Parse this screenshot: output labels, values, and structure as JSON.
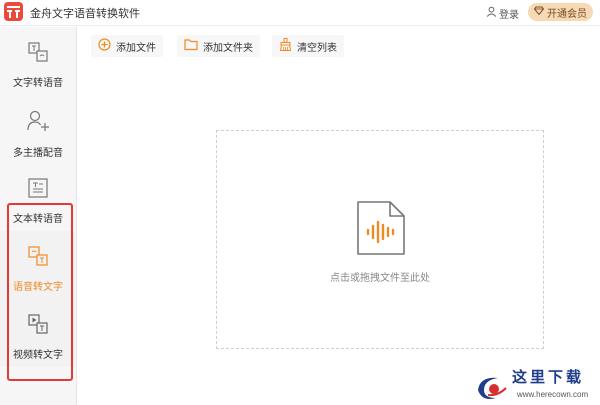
{
  "app": {
    "title": "金舟文字语音转换软件"
  },
  "header": {
    "login_label": "登录",
    "vip_label": "开通会员"
  },
  "sidebar": {
    "items": [
      {
        "label": "文字转语音",
        "active": false
      },
      {
        "label": "多主播配音",
        "active": false
      },
      {
        "label": "文本转语音",
        "active": false
      },
      {
        "label": "语音转文字",
        "active": true
      },
      {
        "label": "视频转文字",
        "active": false
      }
    ]
  },
  "toolbar": {
    "add_file": "添加文件",
    "add_folder": "添加文件夹",
    "clear_list": "清空列表"
  },
  "dropzone": {
    "hint": "点击或拖拽文件至此处"
  },
  "watermark": {
    "text": "这里下载",
    "url": "www.herecown.com"
  },
  "colors": {
    "accent": "#f08a24",
    "logo_red": "#ea4a39",
    "highlight_frame": "#e53935",
    "vip_bg": "#f6d9b5"
  },
  "icons": [
    "app-logo-icon",
    "user-icon",
    "diamond-icon",
    "text-to-speech-icon",
    "multi-speaker-icon",
    "document-icon",
    "speech-to-text-icon",
    "video-to-text-icon",
    "plus-circle-icon",
    "folder-icon",
    "broom-icon",
    "audio-file-icon"
  ]
}
